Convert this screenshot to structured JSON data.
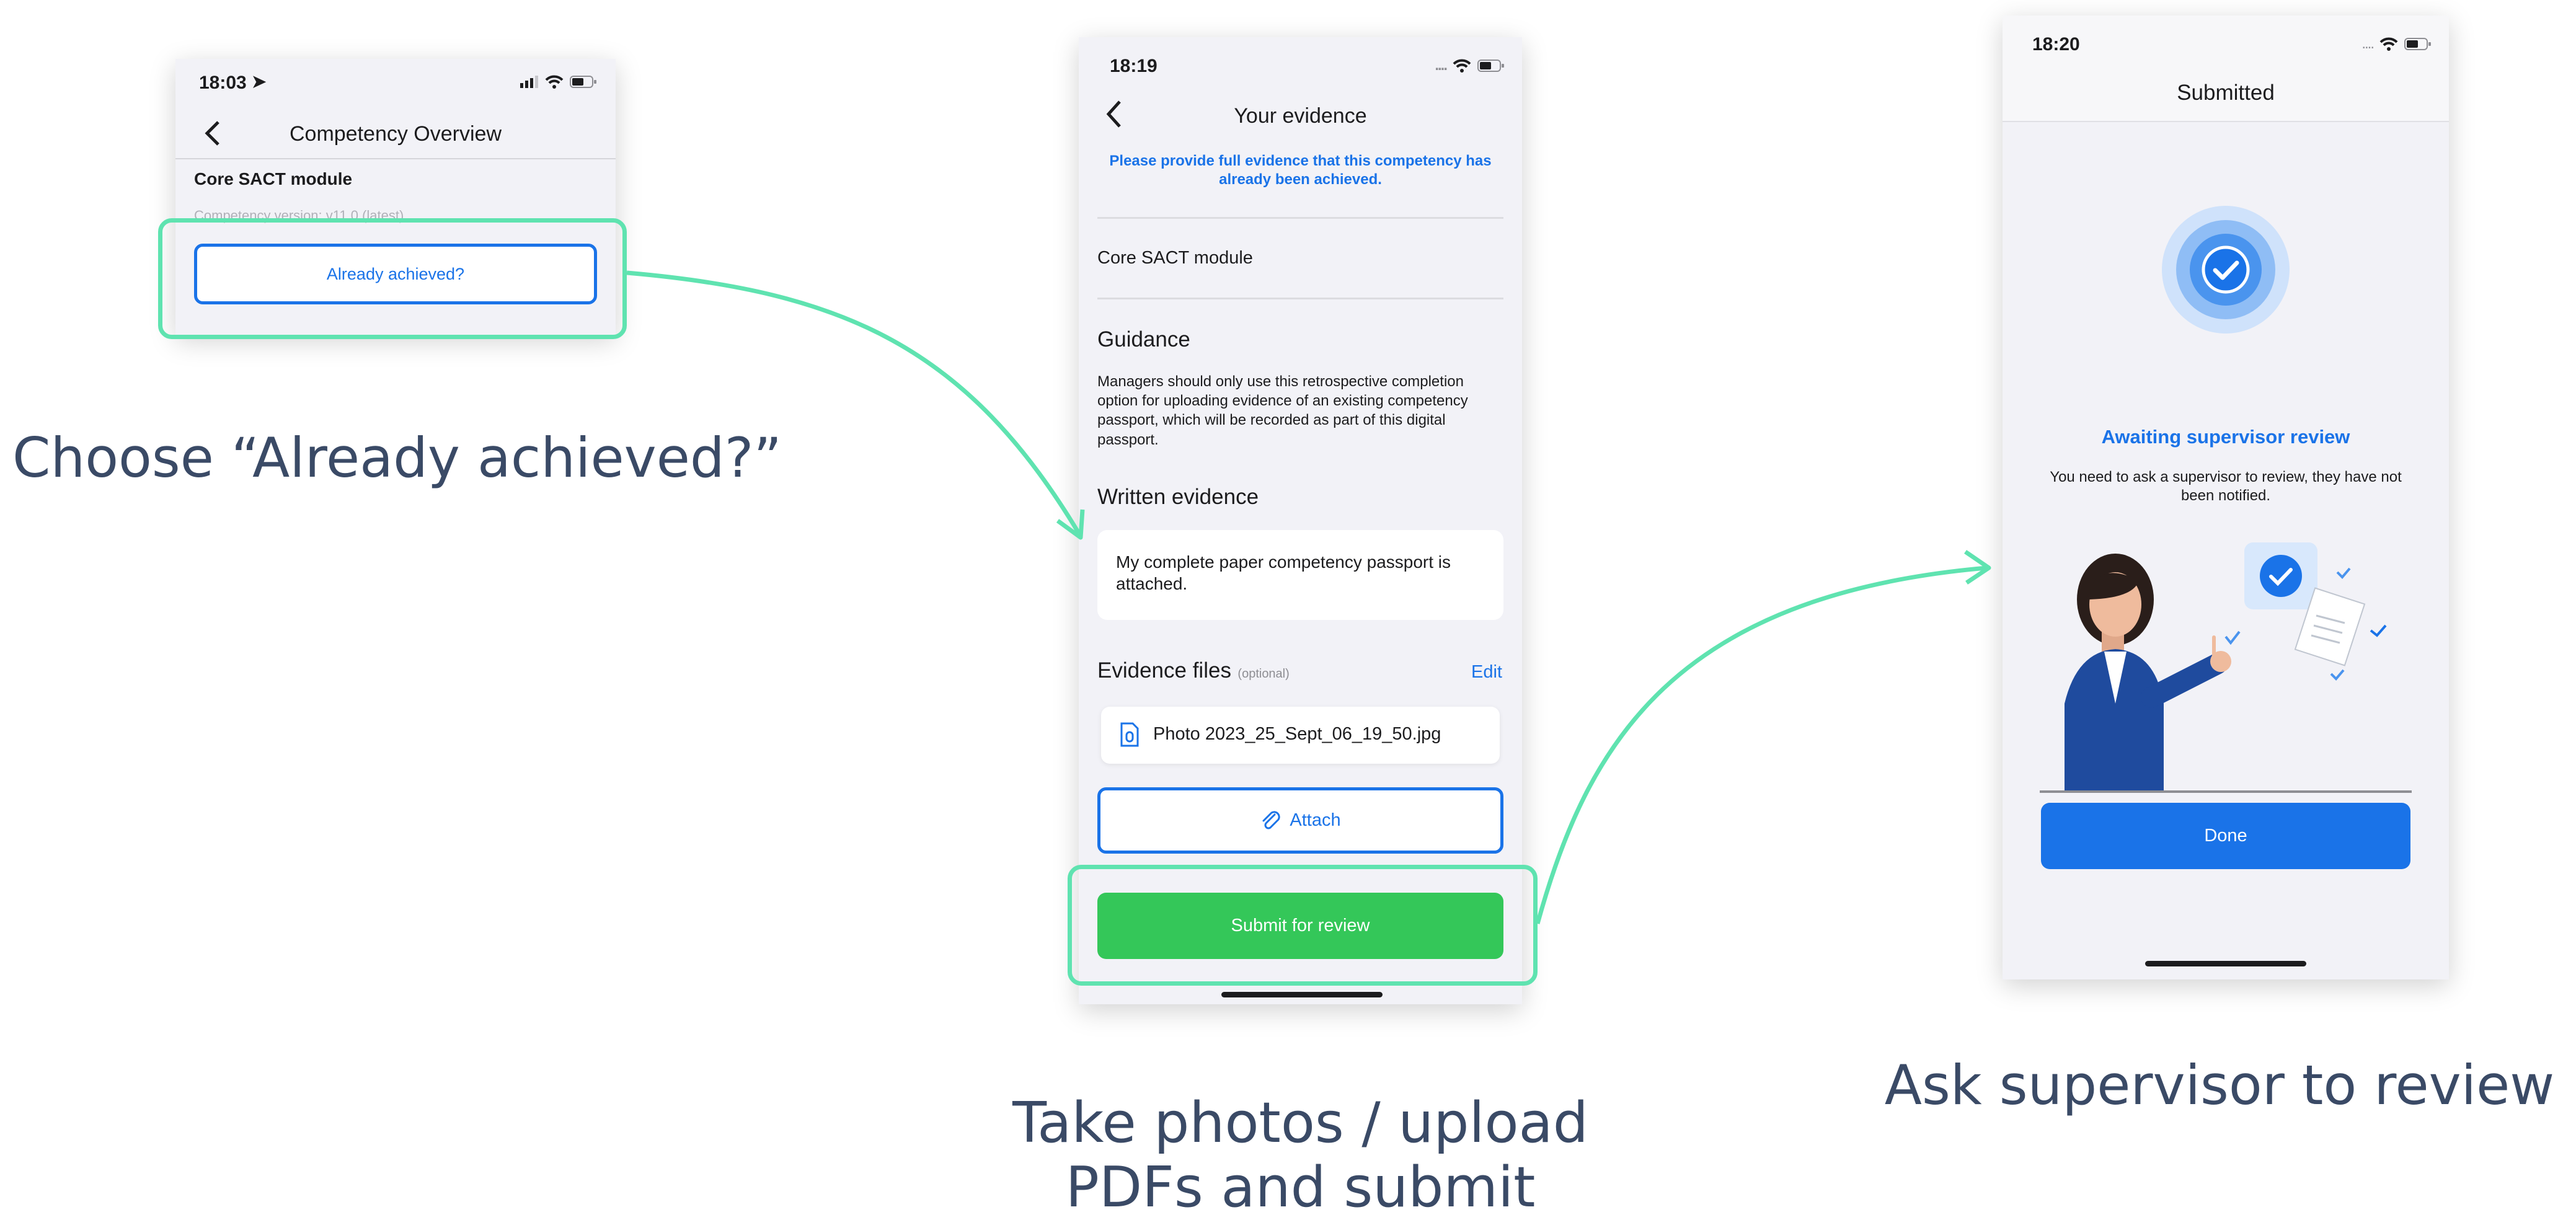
{
  "screen1": {
    "time": "18:03",
    "title": "Competency Overview",
    "module": "Core SACT module",
    "version": "Competency version: v11.0 (latest)",
    "button": "Already achieved?"
  },
  "screen2": {
    "time": "18:19",
    "title": "Your evidence",
    "notice": "Please provide full evidence that this competency has already been achieved.",
    "module": "Core SACT module",
    "guidance_heading": "Guidance",
    "guidance_text": "Managers should only use this retrospective completion option for uploading evidence of an existing competency passport, which will be recorded as part of this digital passport.",
    "written_heading": "Written evidence",
    "written_value": "My complete paper competency passport is attached.",
    "files_heading": "Evidence files",
    "files_optional": "(optional)",
    "edit_label": "Edit",
    "file_name": "Photo 2023_25_Sept_06_19_50.jpg",
    "attach_label": "Attach",
    "submit_label": "Submit for review"
  },
  "screen3": {
    "time": "18:20",
    "title": "Submitted",
    "status_heading": "Awaiting supervisor review",
    "status_text": "You need to ask a supervisor to review, they have not been notified.",
    "done_label": "Done"
  },
  "captions": {
    "step1": "Choose “Already achieved?”",
    "step2": "Take photos / upload PDFs and submit",
    "step3": "Ask supervisor to review"
  },
  "colors": {
    "accent_blue": "#1a73e8",
    "submit_green": "#34c759",
    "highlight": "#5fe3b0",
    "caption": "#3a4a66"
  }
}
